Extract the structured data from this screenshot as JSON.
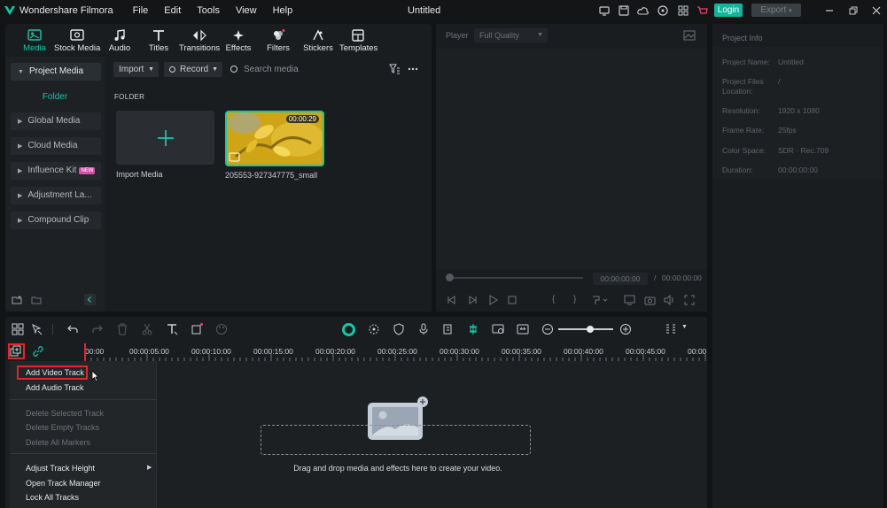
{
  "app": {
    "name": "Wondershare Filmora",
    "window_title": "Untitled",
    "menu": [
      "File",
      "Edit",
      "Tools",
      "View",
      "Help"
    ],
    "login_label": "Login",
    "export_label": "Export",
    "accent": "#14c8a8"
  },
  "toolbar": {
    "tabs": [
      {
        "label": "Media",
        "icon": "media-icon",
        "active": true
      },
      {
        "label": "Stock Media",
        "icon": "stock-media-icon"
      },
      {
        "label": "Audio",
        "icon": "music-note-icon"
      },
      {
        "label": "Titles",
        "icon": "titles-icon"
      },
      {
        "label": "Transitions",
        "icon": "transitions-icon"
      },
      {
        "label": "Effects",
        "icon": "effects-icon"
      },
      {
        "label": "Filters",
        "icon": "filters-icon"
      },
      {
        "label": "Stickers",
        "icon": "stickers-icon"
      },
      {
        "label": "Templates",
        "icon": "templates-icon"
      }
    ]
  },
  "sidebar": {
    "items": [
      {
        "label": "Project Media",
        "active": true
      },
      {
        "label": "Global Media"
      },
      {
        "label": "Cloud Media"
      },
      {
        "label": "Influence Kit",
        "badge": "NEW"
      },
      {
        "label": "Adjustment La..."
      },
      {
        "label": "Compound Clip"
      }
    ],
    "folder_label": "Folder"
  },
  "media": {
    "import_label": "Import",
    "record_label": "Record",
    "search_placeholder": "Search media",
    "folder_header": "FOLDER",
    "import_card_label": "Import Media",
    "clip": {
      "name": "205553-927347775_small",
      "duration": "00:00:29"
    }
  },
  "player": {
    "label": "Player",
    "quality": "Full Quality",
    "current_time": "00:00:00:00",
    "separator": "/",
    "total_time": "00:00:00:00"
  },
  "project_info": {
    "header": "Project Info",
    "fields": [
      {
        "key": "Project Name:",
        "value": "Untitled"
      },
      {
        "key": "Project Files Location:",
        "value": "/"
      },
      {
        "key": "Resolution:",
        "value": "1920 x 1080"
      },
      {
        "key": "Frame Rate:",
        "value": "25fps"
      },
      {
        "key": "Color Space:",
        "value": "SDR - Rec.709"
      },
      {
        "key": "Duration:",
        "value": "00:00:00:00"
      }
    ]
  },
  "timeline": {
    "ruler": [
      "00:00",
      "00:00:05:00",
      "00:00:10:00",
      "00:00:15:00",
      "00:00:20:00",
      "00:00:25:00",
      "00:00:30:00",
      "00:00:35:00",
      "00:00:40:00",
      "00:00:45:00",
      "00:00"
    ],
    "drop_text": "Drag and drop media and effects here to create your video."
  },
  "context_menu": {
    "items": [
      {
        "label": "Add Video Track",
        "highlighted": true
      },
      {
        "label": "Add Audio Track"
      },
      {
        "label": "Delete Selected Track",
        "disabled": true
      },
      {
        "label": "Delete Empty Tracks",
        "disabled": true
      },
      {
        "label": "Delete All Markers",
        "disabled": true
      },
      {
        "label": "Adjust Track Height",
        "submenu": true
      },
      {
        "label": "Open Track Manager"
      },
      {
        "label": "Lock All Tracks"
      }
    ]
  }
}
